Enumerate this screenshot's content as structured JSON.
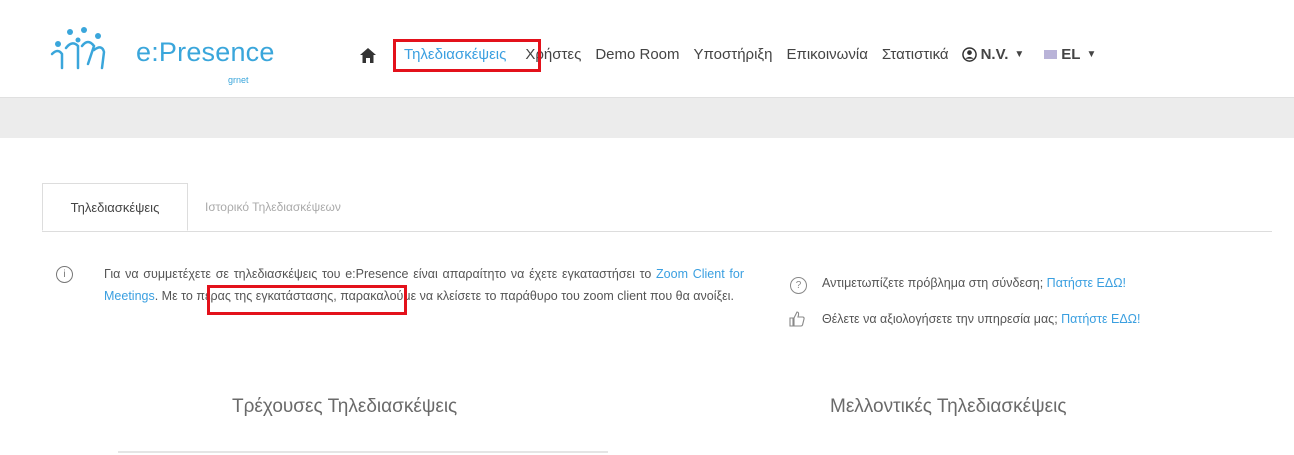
{
  "logo": {
    "text": "e:Presence",
    "subtext": "grnet"
  },
  "nav": {
    "home_icon": "home-icon",
    "items": [
      "Τηλεδιασκέψεις",
      "Χρήστες",
      "Demo Room",
      "Υποστήριξη",
      "Επικοινωνία",
      "Στατιστικά"
    ],
    "user_label": "N.V.",
    "lang_label": "EL"
  },
  "tabs": {
    "active": "Τηλεδιασκέψεις",
    "inactive": "Ιστορικό Τηλεδιασκέψεων"
  },
  "info": {
    "before": "Για να συμμετέχετε σε τηλεδιασκέψεις του e:Presence είναι απαραίτητο να έχετε εγκαταστήσει το ",
    "link": "Zoom Client for Meetings",
    "after": ". Με το πέρας της εγκατάστασης, παρακαλούμε να κλείσετε το παράθυρο του zoom client που θα ανοίξει."
  },
  "side": {
    "problem_text": "Αντιμετωπίζετε πρόβλημα στη σύνδεση; ",
    "problem_link": "Πατήστε ΕΔΩ!",
    "rate_text": "Θέλετε να αξιολογήσετε την υπηρεσία μας; ",
    "rate_link": "Πατήστε ΕΔΩ!"
  },
  "sections": {
    "current": "Τρέχουσες Τηλεδιασκέψεις",
    "future": "Μελλοντικές Τηλεδιασκέψεις"
  },
  "colors": {
    "brand": "#3aa6db",
    "highlight": "#e3111b",
    "link": "#3a9fe0"
  }
}
